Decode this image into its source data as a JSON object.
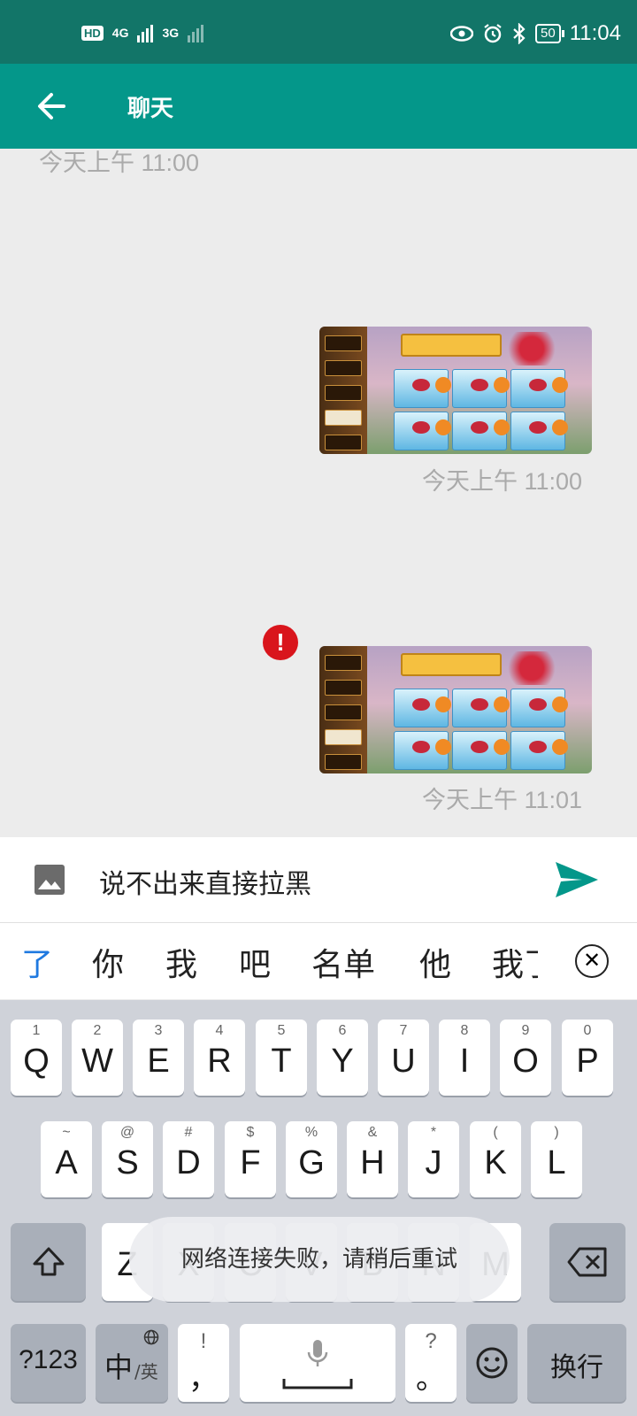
{
  "status_bar": {
    "hd_label": "HD",
    "sim1_network": "4G",
    "sim2_network": "3G",
    "battery": "50",
    "time": "11:04",
    "icons": [
      "eye-icon",
      "alarm-icon",
      "bluetooth-icon",
      "battery-icon"
    ]
  },
  "app_bar": {
    "title": "聊天",
    "back_icon": "back-arrow-icon"
  },
  "chat": {
    "messages": [
      {
        "type": "timestamp",
        "text": "今天上午 11:00"
      },
      {
        "type": "image",
        "timestamp": "今天上午 11:00",
        "status": "sent"
      },
      {
        "type": "image",
        "timestamp": "今天上午 11:01",
        "status": "failed",
        "error_icon": "!"
      }
    ]
  },
  "input_bar": {
    "text": "说不出来直接拉黑",
    "image_icon": "image-icon",
    "send_icon": "send-icon"
  },
  "candidates": [
    "了",
    "你",
    "我",
    "吧",
    "名单",
    "他",
    "我了"
  ],
  "keyboard": {
    "row1": [
      [
        "1",
        "Q"
      ],
      [
        "2",
        "W"
      ],
      [
        "3",
        "E"
      ],
      [
        "4",
        "R"
      ],
      [
        "5",
        "T"
      ],
      [
        "6",
        "Y"
      ],
      [
        "7",
        "U"
      ],
      [
        "8",
        "I"
      ],
      [
        "9",
        "O"
      ],
      [
        "0",
        "P"
      ]
    ],
    "row2": [
      [
        "~",
        "A"
      ],
      [
        "@",
        "S"
      ],
      [
        "#",
        "D"
      ],
      [
        "$",
        "F"
      ],
      [
        "%",
        "G"
      ],
      [
        "&",
        "H"
      ],
      [
        "*",
        "J"
      ],
      [
        "(",
        "K"
      ],
      [
        ")",
        "L"
      ]
    ],
    "row3": [
      "Z",
      "X",
      "C",
      "V",
      "B",
      "N",
      "M"
    ],
    "shift_icon": "shift-icon",
    "backspace_icon": "backspace-icon",
    "num_key": "?123",
    "lang_key_main": "中",
    "lang_key_sub": "/英",
    "comma_top": "!",
    "comma_main": "，",
    "period_top": "?",
    "period_main": "。",
    "emoji_icon": "emoji-icon",
    "enter_key": "换行"
  },
  "toast": "网络连接失败，请稍后重试",
  "colors": {
    "status_bar": "#127568",
    "app_bar": "#04978a",
    "send": "#04978a",
    "error": "#d9151c",
    "candidate_highlight": "#1f79e0"
  }
}
